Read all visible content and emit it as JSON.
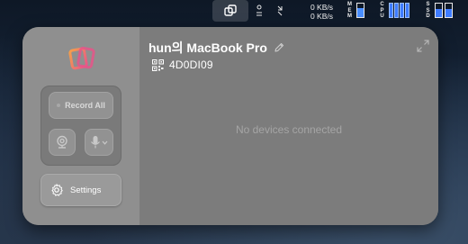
{
  "menubar": {
    "mem_label": "MEM",
    "mem_level": 0.7,
    "cpu_label": "CPU",
    "cpu_bars": 4,
    "ssd_label": "SSD",
    "net_up": "0 KB/s",
    "net_down": "0 KB/s",
    "icons": [
      "app-switcher-icon",
      "sun-icon",
      "arrows-icon"
    ]
  },
  "panel": {
    "device_title": "hun의 MacBook Pro",
    "device_id": "4D0DI09",
    "record_all_label": "Record All",
    "settings_label": "Settings",
    "empty_message": "No devices connected"
  },
  "colors": {
    "cpu_bar": "#3f7cff",
    "panel_left": "#8f8f8f",
    "panel_right": "#7c7c7c",
    "logo_orange": "#f07a3a",
    "logo_pink": "#e8558a"
  }
}
